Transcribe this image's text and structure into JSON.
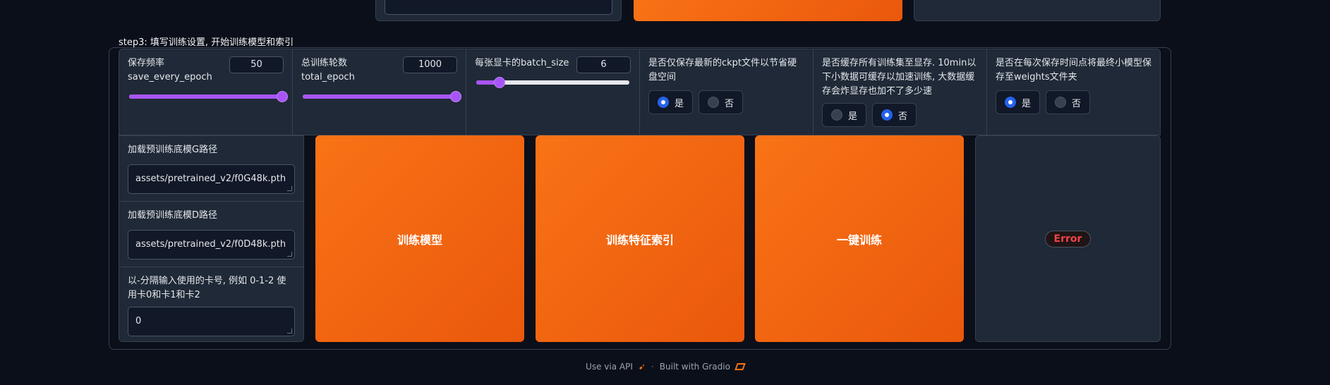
{
  "step3_title": "step3: 填写训练设置, 开始训练模型和索引",
  "settings": {
    "save_freq": {
      "label1": "保存频率",
      "label2": "save_every_epoch",
      "value": "50",
      "slider_fraction": 1.0
    },
    "total_epoch": {
      "label1": "总训练轮数",
      "label2": "total_epoch",
      "value": "1000",
      "slider_fraction": 1.0
    },
    "batch_size": {
      "label": "每张显卡的batch_size",
      "value": "6",
      "slider_fraction": 0.15
    },
    "save_latest": {
      "label": "是否仅保存最新的ckpt文件以节省硬盘空间",
      "yes": "是",
      "no": "否",
      "selected": "yes"
    },
    "cache_gpu": {
      "label": "是否缓存所有训练集至显存. 10min以下小数据可缓存以加速训练, 大数据缓存会炸显存也加不了多少速",
      "yes": "是",
      "no": "否",
      "selected": "no"
    },
    "save_weights": {
      "label": "是否在每次保存时间点将最终小模型保存至weights文件夹",
      "yes": "是",
      "no": "否",
      "selected": "yes"
    }
  },
  "pretrained_g": {
    "label": "加载预训练底模G路径",
    "value": "assets/pretrained_v2/f0G48k.pth"
  },
  "pretrained_d": {
    "label": "加载预训练底模D路径",
    "value": "assets/pretrained_v2/f0D48k.pth"
  },
  "gpus": {
    "label": "以-分隔输入使用的卡号, 例如 0-1-2 使用卡0和卡1和卡2",
    "value": "0"
  },
  "buttons": {
    "train_model": "训练模型",
    "train_index": "训练特征索引",
    "one_click": "一键训练"
  },
  "output": {
    "status": "Error"
  },
  "footer": {
    "api": "Use via API",
    "sep": "·",
    "built": "Built with Gradio"
  },
  "colors": {
    "accent": "#f97316",
    "slider": "#a855f7",
    "radio": "#2563eb",
    "error": "#ef4444"
  }
}
